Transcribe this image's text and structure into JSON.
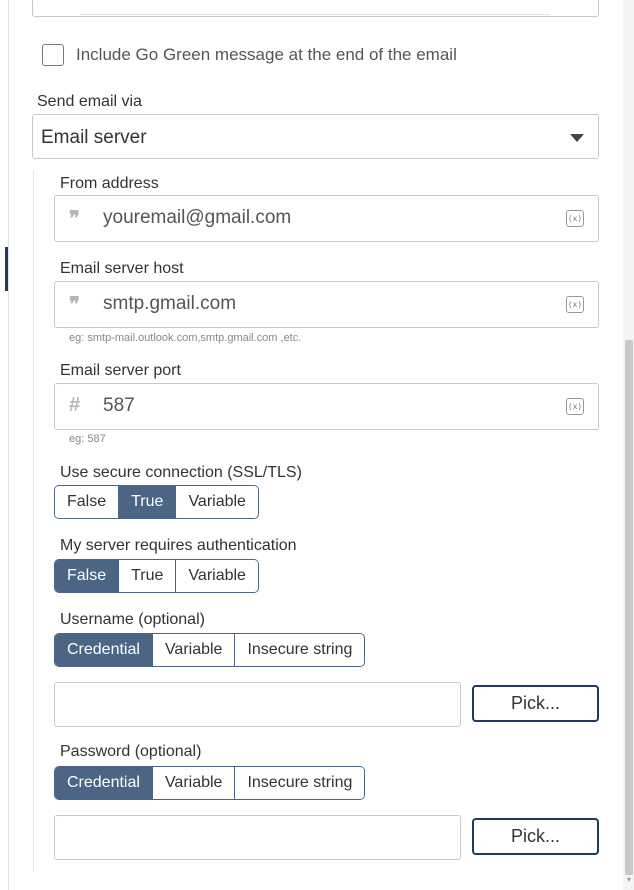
{
  "go_green": {
    "label": "Include Go Green message at the end of the email",
    "checked": false
  },
  "send_via": {
    "label": "Send email via",
    "value": "Email server"
  },
  "from_address": {
    "label": "From address",
    "icon": "quote-icon",
    "value": "youremail@gmail.com",
    "variable_icon": "(x)"
  },
  "server_host": {
    "label": "Email server host",
    "icon": "quote-icon",
    "value": "smtp.gmail.com",
    "variable_icon": "(x)",
    "hint": "eg: smtp-mail.outlook.com,smtp.gmail.com ,etc."
  },
  "server_port": {
    "label": "Email server port",
    "icon": "hash-icon",
    "value": "587",
    "variable_icon": "(x)",
    "hint": "eg: 587"
  },
  "secure": {
    "label": "Use secure connection (SSL/TLS)",
    "options": [
      "False",
      "True",
      "Variable"
    ],
    "selected": "True"
  },
  "auth": {
    "label": "My server requires authentication",
    "options": [
      "False",
      "True",
      "Variable"
    ],
    "selected": "False"
  },
  "username": {
    "label": "Username (optional)",
    "options": [
      "Credential",
      "Variable",
      "Insecure string"
    ],
    "selected": "Credential",
    "value": "",
    "pick_label": "Pick..."
  },
  "password": {
    "label": "Password (optional)",
    "options": [
      "Credential",
      "Variable",
      "Insecure string"
    ],
    "selected": "Credential",
    "value": "",
    "pick_label": "Pick..."
  },
  "colors": {
    "accent": "#4d6584",
    "dark_accent": "#1f3a5f"
  }
}
